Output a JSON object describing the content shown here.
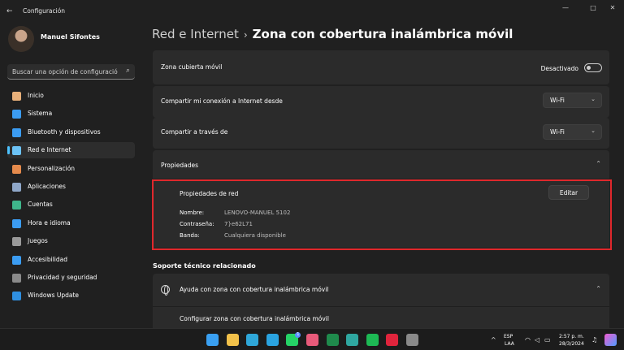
{
  "window": {
    "app_title": "Configuración",
    "back_glyph": "←",
    "minimize_glyph": "—",
    "maximize_glyph": "□",
    "close_glyph": "✕"
  },
  "user": {
    "name": "Manuel Sifontes"
  },
  "search": {
    "placeholder": "Buscar una opción de configuración",
    "icon": "search-icon"
  },
  "sidebar": {
    "items": [
      {
        "label": "Inicio",
        "icon": "home-icon",
        "color": "#e8b07a"
      },
      {
        "label": "Sistema",
        "icon": "system-icon",
        "color": "#3b9cf2"
      },
      {
        "label": "Bluetooth y dispositivos",
        "icon": "bluetooth-icon",
        "color": "#3b9cf2"
      },
      {
        "label": "Red e Internet",
        "icon": "network-icon",
        "color": "#6cc2f5",
        "active": true
      },
      {
        "label": "Personalización",
        "icon": "brush-icon",
        "color": "#e58a4c"
      },
      {
        "label": "Aplicaciones",
        "icon": "apps-icon",
        "color": "#8fa7c8"
      },
      {
        "label": "Cuentas",
        "icon": "account-icon",
        "color": "#3fb68b"
      },
      {
        "label": "Hora e idioma",
        "icon": "clock-globe-icon",
        "color": "#3b9cf2"
      },
      {
        "label": "Juegos",
        "icon": "gamepad-icon",
        "color": "#9a9a9a"
      },
      {
        "label": "Accesibilidad",
        "icon": "accessibility-icon",
        "color": "#3b9cf2"
      },
      {
        "label": "Privacidad y seguridad",
        "icon": "shield-icon",
        "color": "#8a8a8a"
      },
      {
        "label": "Windows Update",
        "icon": "update-icon",
        "color": "#2f8fe0"
      }
    ]
  },
  "breadcrumb": {
    "parent": "Red e Internet",
    "separator": "›",
    "current": "Zona con cobertura inalámbrica móvil"
  },
  "hotspot": {
    "label": "Zona cubierta móvil",
    "state": "Desactivado"
  },
  "share_from": {
    "label": "Compartir mi conexión a Internet desde",
    "value": "Wi-Fi"
  },
  "share_over": {
    "label": "Compartir a través de",
    "value": "Wi-Fi"
  },
  "properties": {
    "header": "Propiedades",
    "panel_title": "Propiedades de red",
    "edit_label": "Editar",
    "rows": [
      {
        "key": "Nombre:",
        "value": "LENOVO-MANUEL 5102"
      },
      {
        "key": "Contraseña:",
        "value": "7}e62L71"
      },
      {
        "key": "Banda:",
        "value": "Cualquiera disponible"
      }
    ]
  },
  "support": {
    "section_title": "Soporte técnico relacionado",
    "help_title": "Ayuda con zona con cobertura inalámbrica móvil",
    "help_link": "Configurar zona con cobertura inalámbrica móvil"
  },
  "taskbar": {
    "apps": [
      {
        "icon": "windows-start-icon",
        "color": "#3aa0f2"
      },
      {
        "icon": "file-explorer-icon",
        "color": "#f2c14a"
      },
      {
        "icon": "edge-icon",
        "color": "#2fa7d9"
      },
      {
        "icon": "telegram-icon",
        "color": "#2aa3e0"
      },
      {
        "icon": "whatsapp-icon",
        "color": "#25d366",
        "badge": "1"
      },
      {
        "icon": "app-icon",
        "color": "#e85a7a"
      },
      {
        "icon": "excel-icon",
        "color": "#1f8a4c"
      },
      {
        "icon": "network-app-icon",
        "color": "#2fa7a0"
      },
      {
        "icon": "spotify-icon",
        "color": "#1db954"
      },
      {
        "icon": "opera-icon",
        "color": "#e0243c"
      },
      {
        "icon": "settings-icon",
        "color": "#8a8a8a"
      }
    ],
    "lang_top": "ESP",
    "lang_bottom": "LAA",
    "time": "2:57 p. m.",
    "date": "28/3/2024"
  }
}
